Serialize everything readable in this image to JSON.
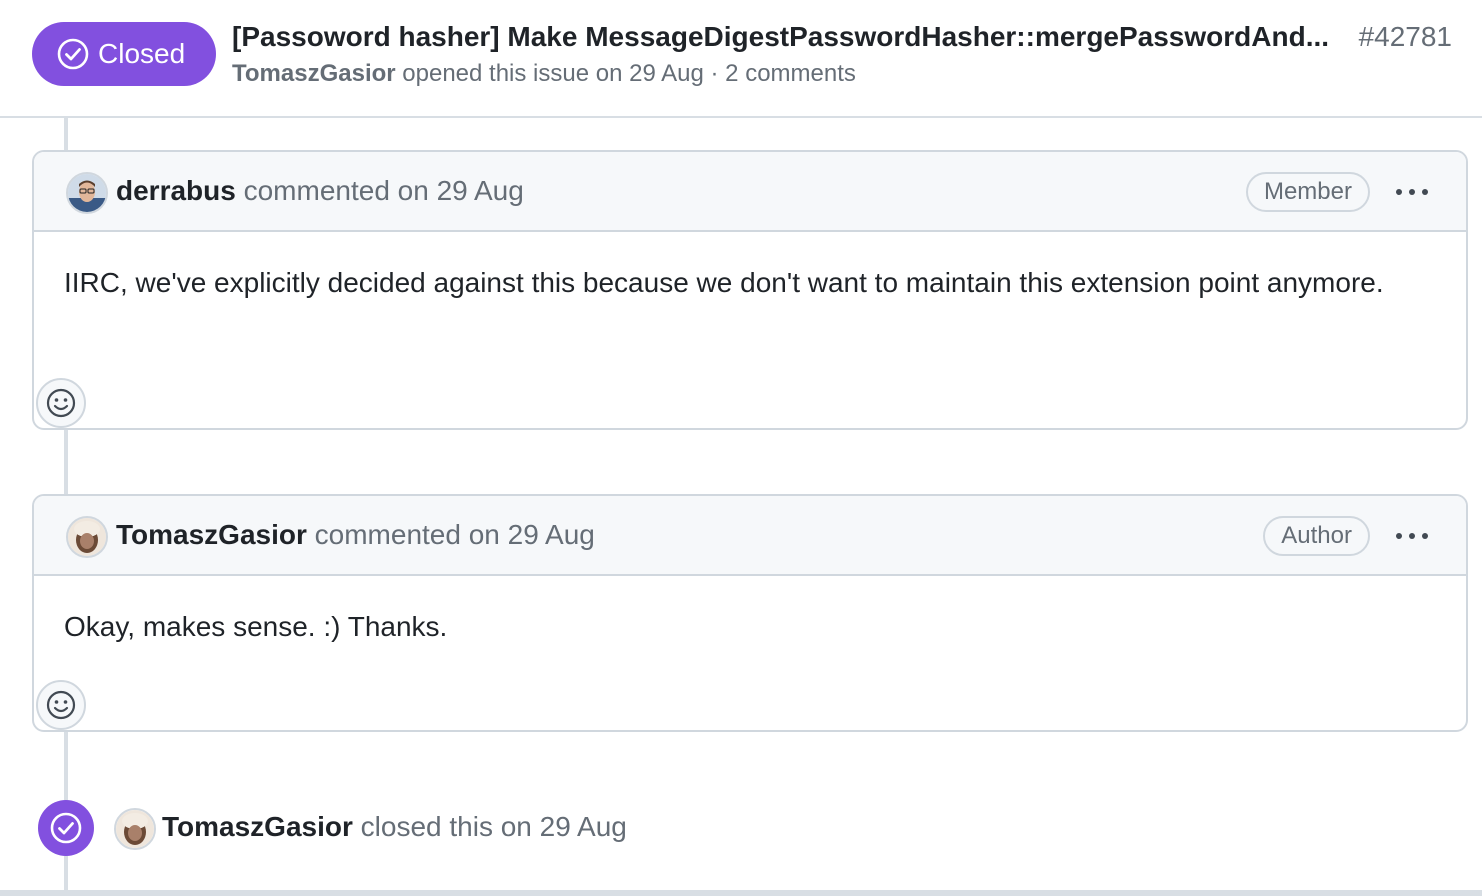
{
  "colors": {
    "closed_purple": "#8250df",
    "muted_text": "#656d76",
    "border": "#d0d7de"
  },
  "header": {
    "state_label": "Closed",
    "state_icon": "check-circle-icon",
    "title": "[Passoword hasher] Make MessageDigestPasswordHasher::mergePasswordAnd...",
    "number": "#42781",
    "author": "TomaszGasior",
    "meta": "opened this issue on 29 Aug · 2 comments"
  },
  "comments": [
    {
      "author": "derrabus",
      "action": "commented on 29 Aug",
      "role": "Member",
      "body": "IIRC, we've explicitly decided against this because we don't want to maintain this extension point anymore."
    },
    {
      "author": "TomaszGasior",
      "action": "commented on 29 Aug",
      "role": "Author",
      "body": "Okay, makes sense. :) Thanks."
    }
  ],
  "event": {
    "icon": "check-circle-icon",
    "author": "TomaszGasior",
    "action": "closed this on 29 Aug"
  }
}
